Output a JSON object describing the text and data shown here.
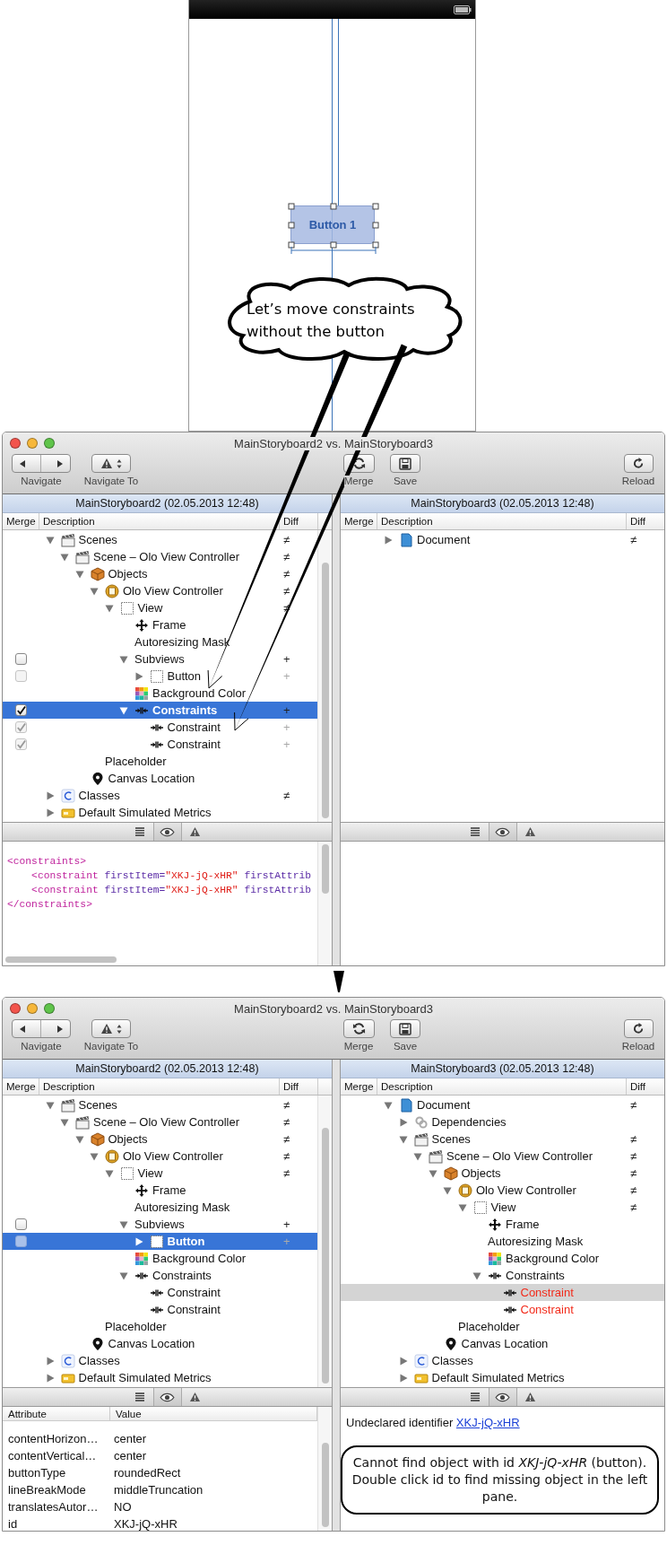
{
  "canvas": {
    "button_label": "Button 1",
    "callout": "Let’s move constraints without the button"
  },
  "windows": [
    {
      "title": "MainStoryboard2 vs. MainStoryboard3",
      "toolbar": [
        {
          "kind": "navigate",
          "label": "Navigate"
        },
        {
          "kind": "navigate_to",
          "label": "Navigate To"
        },
        {
          "kind": "merge",
          "label": "Merge"
        },
        {
          "kind": "save",
          "label": "Save"
        },
        {
          "kind": "reload",
          "label": "Reload"
        }
      ],
      "panes": [
        {
          "title": "MainStoryboard2 (02.05.2013 12:48)",
          "active": true,
          "columns": [
            "Merge",
            "Description",
            "Diff"
          ],
          "tree": [
            {
              "label": "Scenes",
              "kind": "scenes",
              "expanded": true,
              "diff": "≠",
              "selected": false,
              "children": [
                {
                  "label": "Scene – Olo View Controller",
                  "kind": "scene",
                  "expanded": true,
                  "diff": "≠",
                  "selected": false,
                  "children": [
                    {
                      "label": "Objects",
                      "kind": "objects",
                      "expanded": true,
                      "diff": "≠",
                      "selected": false,
                      "children": [
                        {
                          "label": "Olo View Controller",
                          "kind": "controller",
                          "expanded": true,
                          "diff": "≠",
                          "selected": false,
                          "children": [
                            {
                              "label": "View",
                              "kind": "view",
                              "expanded": true,
                              "diff": "≠",
                              "selected": false,
                              "children": [
                                {
                                  "label": "Frame",
                                  "kind": "frame",
                                  "selected": false
                                },
                                {
                                  "label": "Autoresizing Mask",
                                  "kind": "text",
                                  "selected": false
                                },
                                {
                                  "label": "Subviews",
                                  "kind": "group",
                                  "expanded": true,
                                  "checked": false,
                                  "disabled": false,
                                  "diff": "+",
                                  "selected": false,
                                  "children": [
                                    {
                                      "label": "Button",
                                      "kind": "view",
                                      "expanded": false,
                                      "checked": false,
                                      "disabled": true,
                                      "diff": "+",
                                      "selected": false
                                    }
                                  ]
                                },
                                {
                                  "label": "Background Color",
                                  "kind": "color",
                                  "selected": false
                                },
                                {
                                  "label": "Constraints",
                                  "kind": "constraint",
                                  "expanded": true,
                                  "checked": true,
                                  "disabled": false,
                                  "diff": "+",
                                  "selected": true,
                                  "children": [
                                    {
                                      "label": "Constraint",
                                      "kind": "constraint",
                                      "checked": true,
                                      "disabled": true,
                                      "diff": "+",
                                      "selected": false
                                    },
                                    {
                                      "label": "Constraint",
                                      "kind": "constraint",
                                      "checked": true,
                                      "disabled": true,
                                      "diff": "+",
                                      "selected": false
                                    }
                                  ]
                                }
                              ]
                            }
                          ]
                        },
                        {
                          "label": "Placeholder",
                          "kind": "text",
                          "selected": false
                        }
                      ]
                    },
                    {
                      "label": "Canvas Location",
                      "kind": "location",
                      "selected": false
                    }
                  ]
                }
              ]
            },
            {
              "label": "Classes",
              "kind": "class",
              "expanded": false,
              "diff": "≠",
              "selected": false
            },
            {
              "label": "Default Simulated Metrics",
              "kind": "metrics",
              "expanded": false,
              "selected": false
            }
          ],
          "detail": {
            "kind": "code",
            "lines": [
              [
                {
                  "kind": "tag",
                  "text": "<constraints>"
                }
              ],
              [
                {
                  "kind": "tag",
                  "text": "    <constraint"
                },
                {
                  "kind": "attr",
                  "text": " firstItem="
                },
                {
                  "kind": "value",
                  "text": "\"XKJ-jQ-xHR\""
                },
                {
                  "kind": "attr",
                  "text": " firstAttrib"
                }
              ],
              [
                {
                  "kind": "tag",
                  "text": "    <constraint"
                },
                {
                  "kind": "attr",
                  "text": " firstItem="
                },
                {
                  "kind": "value",
                  "text": "\"XKJ-jQ-xHR\""
                },
                {
                  "kind": "attr",
                  "text": " firstAttrib"
                }
              ],
              [
                {
                  "kind": "tag",
                  "text": "</constraints>"
                }
              ]
            ]
          }
        },
        {
          "title": "MainStoryboard3 (02.05.2013 12:48)",
          "columns": [
            "Merge",
            "Description",
            "Diff"
          ],
          "tree": [
            {
              "label": "Document",
              "kind": "document",
              "expanded": false,
              "diff": "≠",
              "selected": false
            }
          ],
          "detail": {
            "kind": "empty"
          }
        }
      ]
    },
    {
      "title": "MainStoryboard2 vs. MainStoryboard3",
      "toolbar": [
        {
          "kind": "navigate",
          "label": "Navigate"
        },
        {
          "kind": "navigate_to",
          "label": "Navigate To"
        },
        {
          "kind": "merge",
          "label": "Merge"
        },
        {
          "kind": "save",
          "label": "Save"
        },
        {
          "kind": "reload",
          "label": "Reload"
        }
      ],
      "panes": [
        {
          "title": "MainStoryboard2 (02.05.2013 12:48)",
          "active": true,
          "columns": [
            "Merge",
            "Description",
            "Diff"
          ],
          "tree": [
            {
              "label": "Scenes",
              "kind": "scenes",
              "expanded": true,
              "diff": "≠",
              "selected": false,
              "children": [
                {
                  "label": "Scene – Olo View Controller",
                  "kind": "scene",
                  "expanded": true,
                  "diff": "≠",
                  "selected": false,
                  "children": [
                    {
                      "label": "Objects",
                      "kind": "objects",
                      "expanded": true,
                      "diff": "≠",
                      "selected": false,
                      "children": [
                        {
                          "label": "Olo View Controller",
                          "kind": "controller",
                          "expanded": true,
                          "diff": "≠",
                          "selected": false,
                          "children": [
                            {
                              "label": "View",
                              "kind": "view",
                              "expanded": true,
                              "diff": "≠",
                              "selected": false,
                              "children": [
                                {
                                  "label": "Frame",
                                  "kind": "frame",
                                  "selected": false
                                },
                                {
                                  "label": "Autoresizing Mask",
                                  "kind": "text",
                                  "selected": false
                                },
                                {
                                  "label": "Subviews",
                                  "kind": "group",
                                  "expanded": true,
                                  "checked": false,
                                  "disabled": false,
                                  "diff": "+",
                                  "selected": false,
                                  "children": [
                                    {
                                      "label": "Button",
                                      "kind": "view",
                                      "expanded": false,
                                      "checked": false,
                                      "disabled": true,
                                      "diff": "+",
                                      "selected": true
                                    }
                                  ]
                                },
                                {
                                  "label": "Background Color",
                                  "kind": "color",
                                  "selected": false
                                },
                                {
                                  "label": "Constraints",
                                  "kind": "constraint",
                                  "expanded": true,
                                  "selected": false,
                                  "children": [
                                    {
                                      "label": "Constraint",
                                      "kind": "constraint",
                                      "selected": false
                                    },
                                    {
                                      "label": "Constraint",
                                      "kind": "constraint",
                                      "selected": false
                                    }
                                  ]
                                }
                              ]
                            }
                          ]
                        },
                        {
                          "label": "Placeholder",
                          "kind": "text",
                          "selected": false
                        }
                      ]
                    },
                    {
                      "label": "Canvas Location",
                      "kind": "location",
                      "selected": false
                    }
                  ]
                }
              ]
            },
            {
              "label": "Classes",
              "kind": "class",
              "expanded": false,
              "selected": false
            },
            {
              "label": "Default Simulated Metrics",
              "kind": "metrics",
              "expanded": false,
              "selected": false
            }
          ],
          "detail": {
            "kind": "attributes",
            "columns": [
              "Attribute",
              "Value"
            ],
            "rows": [
              [
                "contentHorizon…",
                "center"
              ],
              [
                "contentVertical…",
                "center"
              ],
              [
                "buttonType",
                "roundedRect"
              ],
              [
                "lineBreakMode",
                "middleTruncation"
              ],
              [
                "translatesAutor…",
                "NO"
              ],
              [
                "id",
                "XKJ-jQ-xHR"
              ]
            ]
          }
        },
        {
          "title": "MainStoryboard3 (02.05.2013 12:48)",
          "active": false,
          "columns": [
            "Merge",
            "Description",
            "Diff"
          ],
          "tree": [
            {
              "label": "Document",
              "kind": "document",
              "expanded": true,
              "diff": "≠",
              "selected": false,
              "children": [
                {
                  "label": "Dependencies",
                  "kind": "dependencies",
                  "expanded": false,
                  "selected": false
                },
                {
                  "label": "Scenes",
                  "kind": "scenes",
                  "expanded": true,
                  "diff": "≠",
                  "selected": false,
                  "children": [
                    {
                      "label": "Scene – Olo View Controller",
                      "kind": "scene",
                      "expanded": true,
                      "diff": "≠",
                      "selected": false,
                      "children": [
                        {
                          "label": "Objects",
                          "kind": "objects",
                          "expanded": true,
                          "diff": "≠",
                          "selected": false,
                          "children": [
                            {
                              "label": "Olo View Controller",
                              "kind": "controller",
                              "expanded": true,
                              "diff": "≠",
                              "selected": false,
                              "children": [
                                {
                                  "label": "View",
                                  "kind": "view",
                                  "expanded": true,
                                  "diff": "≠",
                                  "selected": false,
                                  "children": [
                                    {
                                      "label": "Frame",
                                      "kind": "frame",
                                      "selected": false
                                    },
                                    {
                                      "label": "Autoresizing Mask",
                                      "kind": "text",
                                      "selected": false
                                    },
                                    {
                                      "label": "Background Color",
                                      "kind": "color",
                                      "selected": false
                                    },
                                    {
                                      "label": "Constraints",
                                      "kind": "constraint",
                                      "expanded": true,
                                      "selected": false,
                                      "children": [
                                        {
                                          "label": "Constraint",
                                          "kind": "constraint",
                                          "error": true,
                                          "selected": true
                                        },
                                        {
                                          "label": "Constraint",
                                          "kind": "constraint",
                                          "error": true,
                                          "selected": false
                                        }
                                      ]
                                    }
                                  ]
                                }
                              ]
                            },
                            {
                              "label": "Placeholder",
                              "kind": "text",
                              "selected": false
                            }
                          ]
                        },
                        {
                          "label": "Canvas Location",
                          "kind": "location",
                          "selected": false
                        }
                      ]
                    }
                  ]
                },
                {
                  "label": "Classes",
                  "kind": "class",
                  "expanded": false,
                  "selected": false
                },
                {
                  "label": "Default Simulated Metrics",
                  "kind": "metrics",
                  "expanded": false,
                  "selected": false
                }
              ]
            }
          ],
          "detail": {
            "kind": "issues",
            "message": "Undeclared identifier",
            "link": "XKJ-jQ-xHR",
            "note": "Cannot find object with id *XKJ-jQ-xHR* (button). Double click id to find missing object in the left pane."
          }
        }
      ]
    }
  ]
}
